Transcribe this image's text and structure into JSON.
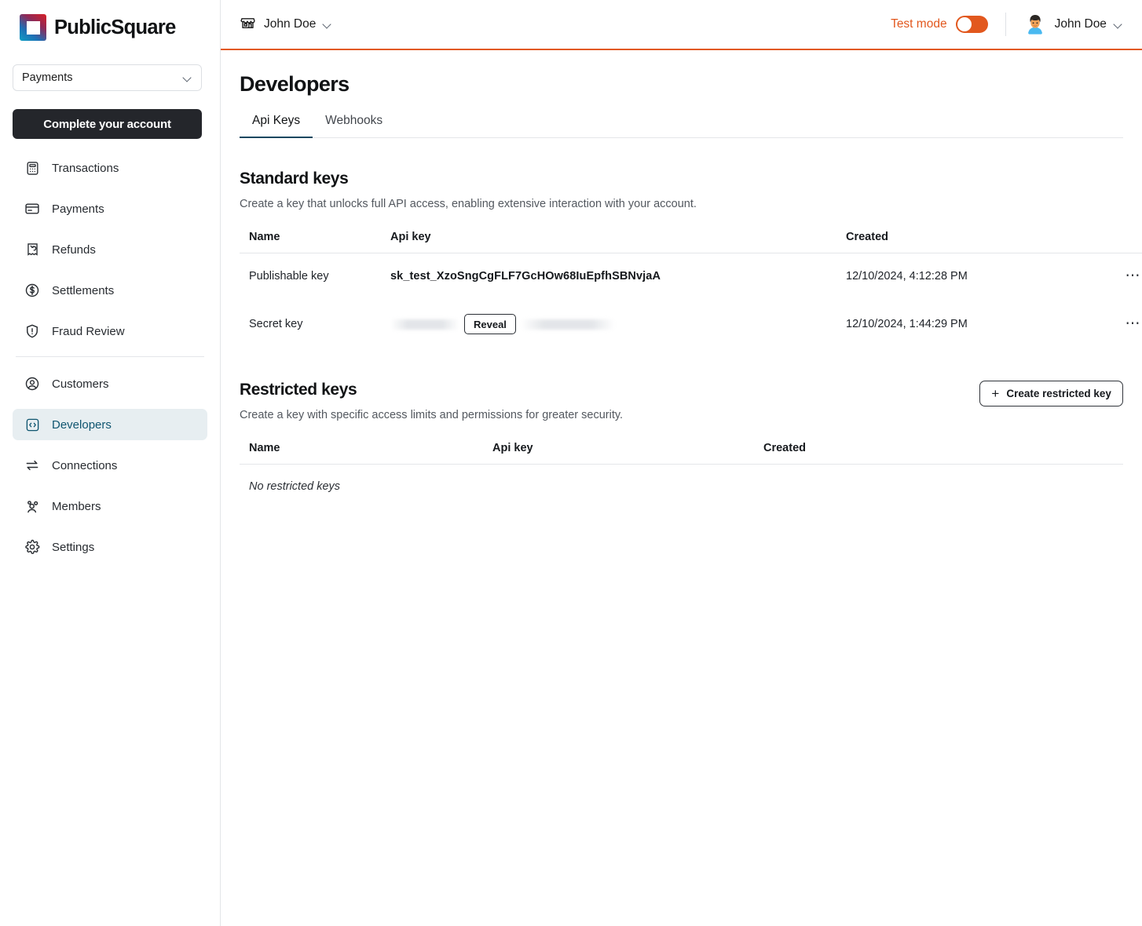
{
  "sidebar": {
    "brand": {
      "name": "PublicSquare",
      "logo_icon": "publicsquare-logo"
    },
    "account_select": {
      "value": "Payments",
      "icon": "chevron-down-icon"
    },
    "cta_button": {
      "label": "Complete your account"
    },
    "items": [
      {
        "label": "Transactions",
        "icon": "calculator-icon",
        "active": false
      },
      {
        "label": "Payments",
        "icon": "credit-card-icon",
        "active": false
      },
      {
        "label": "Refunds",
        "icon": "receipt-refund-icon",
        "active": false
      },
      {
        "label": "Settlements",
        "icon": "dollar-circle-icon",
        "active": false
      },
      {
        "label": "Fraud Review",
        "icon": "shield-alert-icon",
        "active": false
      },
      {
        "label": "Customers",
        "icon": "user-circle-icon",
        "active": false
      },
      {
        "label": "Developers",
        "icon": "code-brackets-icon",
        "active": true
      },
      {
        "label": "Connections",
        "icon": "transfer-arrows-icon",
        "active": false
      },
      {
        "label": "Members",
        "icon": "users-group-icon",
        "active": false
      },
      {
        "label": "Settings",
        "icon": "gear-icon",
        "active": false
      }
    ]
  },
  "topbar": {
    "merchant": {
      "name": "John Doe",
      "icon": "storefront-icon",
      "chevron": "chevron-down-icon"
    },
    "test_mode": {
      "label": "Test mode",
      "enabled": false,
      "color": "#e2581e"
    },
    "user": {
      "name": "John Doe",
      "avatar": "user-avatar",
      "chevron": "chevron-down-icon"
    }
  },
  "page": {
    "title": "Developers",
    "tabs": [
      {
        "label": "Api Keys",
        "active": true
      },
      {
        "label": "Webhooks",
        "active": false
      }
    ]
  },
  "standard_keys": {
    "title": "Standard keys",
    "description": "Create a key that unlocks full API access, enabling extensive interaction with your account.",
    "columns": [
      "Name",
      "Api key",
      "Created",
      ""
    ],
    "rows": [
      {
        "name": "Publishable key",
        "api_key": "sk_test_XzoSngCgFLF7GcHOw68IuEpfhSBNvjaA",
        "masked": false,
        "created": "12/10/2024, 4:12:28 PM",
        "actions_icon": "ellipsis-icon"
      },
      {
        "name": "Secret key",
        "api_key": "",
        "masked": true,
        "reveal_label": "Reveal",
        "created": "12/10/2024, 1:44:29 PM",
        "actions_icon": "ellipsis-icon"
      }
    ]
  },
  "restricted_keys": {
    "title": "Restricted keys",
    "description": "Create a key with specific access limits and permissions for greater security.",
    "create_button": {
      "label": "Create restricted key",
      "icon": "plus-icon"
    },
    "columns": [
      "Name",
      "Api key",
      "Created"
    ],
    "empty_message": "No restricted keys"
  },
  "colors": {
    "accent_orange": "#e2581e",
    "active_nav_bg": "#e7eef1",
    "active_nav_text": "#0f5570",
    "tab_underline": "#13475f",
    "cta_bg": "#24262b"
  }
}
